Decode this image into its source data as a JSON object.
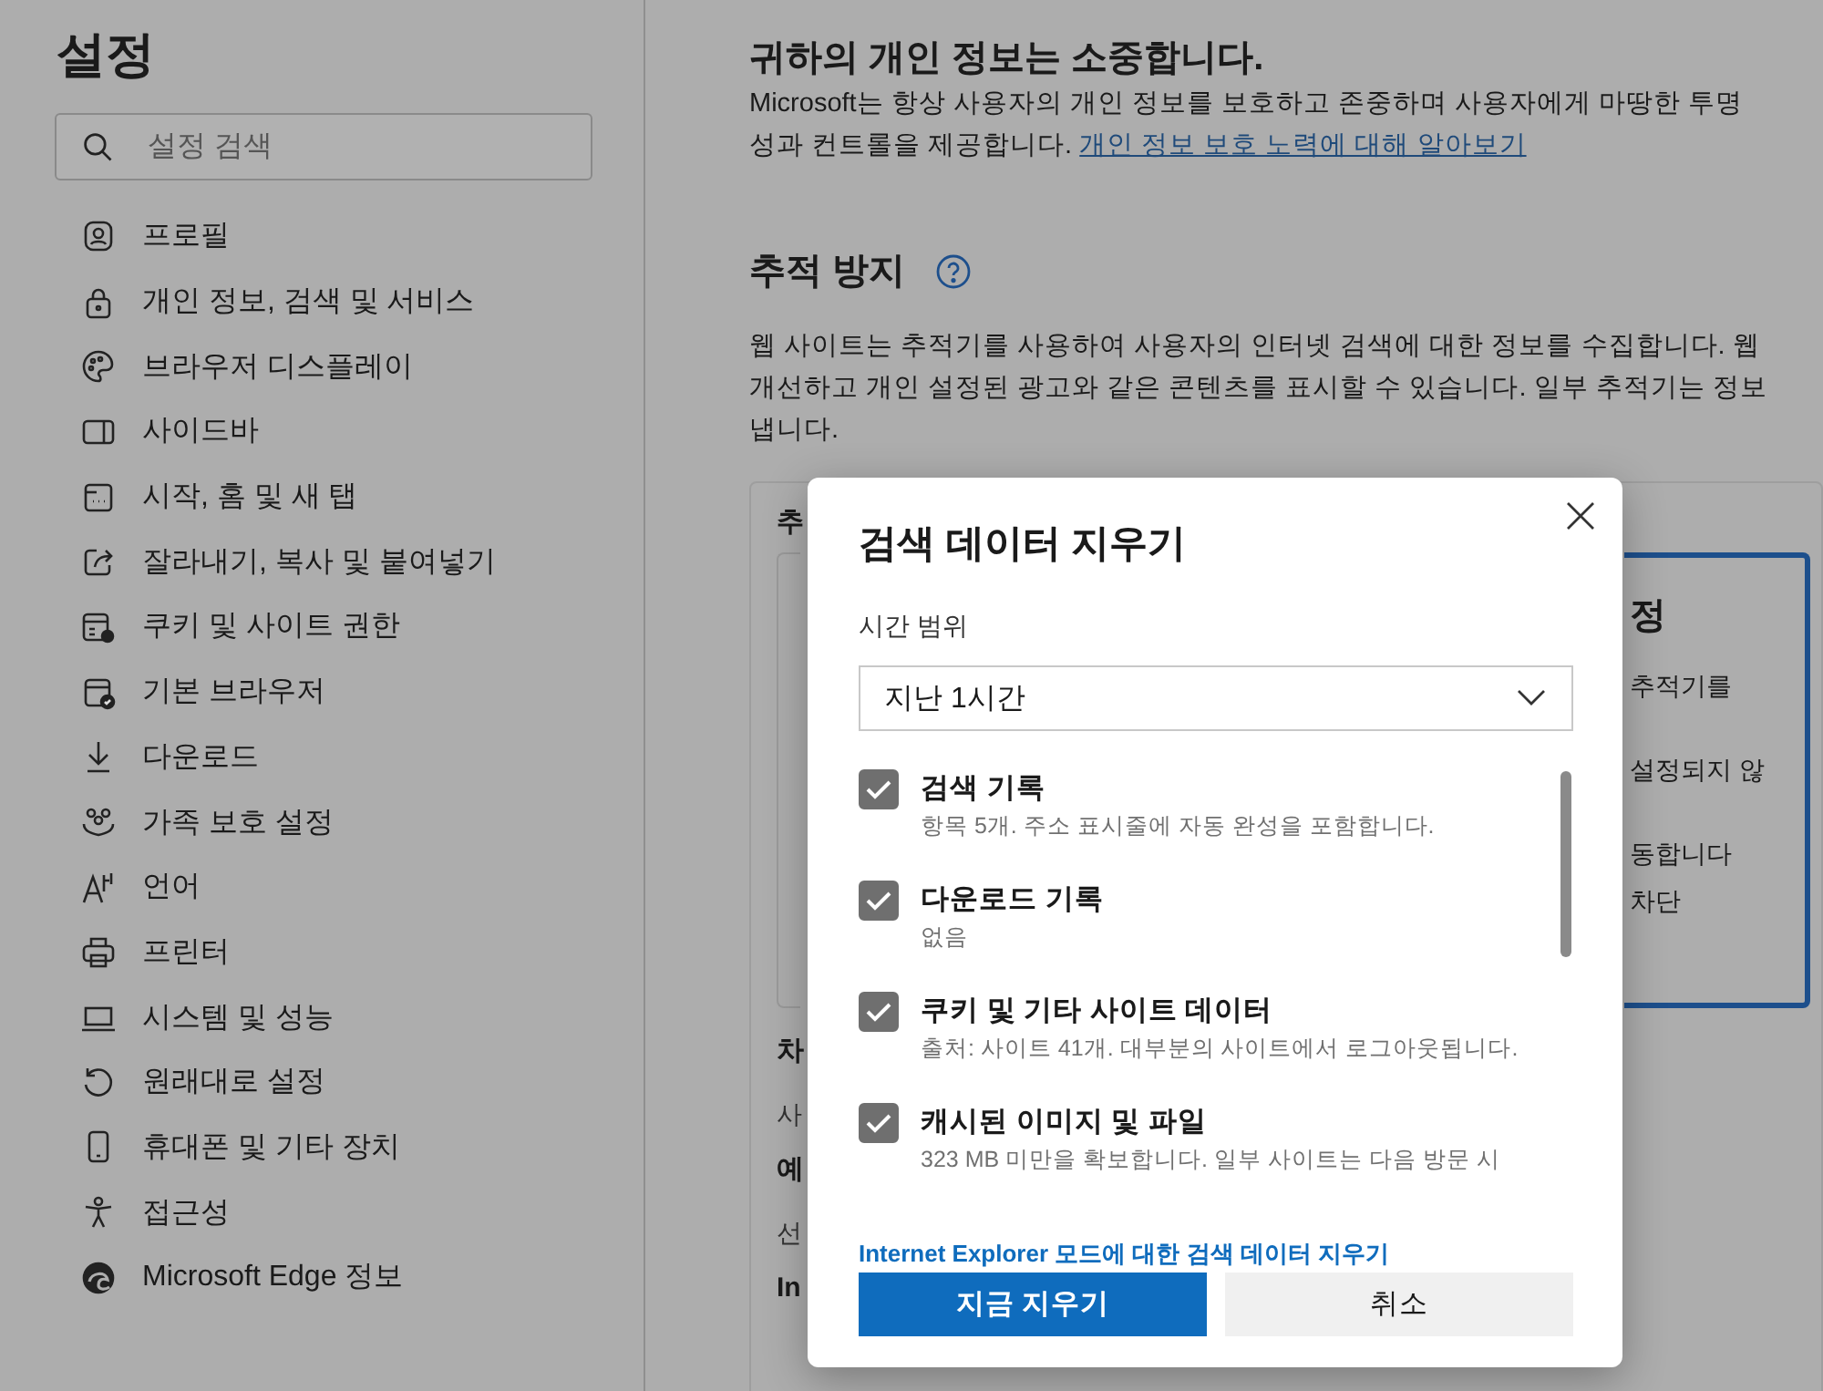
{
  "sidebar": {
    "title": "설정",
    "search": {
      "placeholder": "설정 검색"
    },
    "items": [
      {
        "label": "프로필",
        "selected": false
      },
      {
        "label": "개인 정보, 검색 및 서비스",
        "selected": false
      },
      {
        "label": "브라우저 디스플레이",
        "selected": false
      },
      {
        "label": "사이드바",
        "selected": false
      },
      {
        "label": "시작, 홈 및 새 탭",
        "selected": false
      },
      {
        "label": "잘라내기, 복사 및 붙여넣기",
        "selected": false
      },
      {
        "label": "쿠키 및 사이트 권한",
        "selected": false
      },
      {
        "label": "기본 브라우저",
        "selected": false
      },
      {
        "label": "다운로드",
        "selected": false
      },
      {
        "label": "가족 보호 설정",
        "selected": false
      },
      {
        "label": "언어",
        "selected": false
      },
      {
        "label": "프린터",
        "selected": false
      },
      {
        "label": "시스템 및 성능",
        "selected": false
      },
      {
        "label": "원래대로 설정",
        "selected": false
      },
      {
        "label": "휴대폰 및 기타 장치",
        "selected": false
      },
      {
        "label": "접근성",
        "selected": false
      },
      {
        "label": "Microsoft Edge 정보",
        "selected": false
      }
    ]
  },
  "main": {
    "privacy": {
      "heading": "귀하의 개인 정보는 소중합니다.",
      "lines": [
        "Microsoft는 항상 사용자의 개인 정보를 보호하고 존중하며 사용자에게 마땅한 투명",
        "성과 컨트롤을 제공합니다."
      ],
      "link": "개인 정보 보호 노력에 대해 알아보기"
    },
    "tracking": {
      "heading": "추적 방지",
      "lines": [
        "웹 사이트는 추적기를 사용하여 사용자의 인터넷 검색에 대한 정보를 수집합니다. 웹",
        "개선하고 개인 설정된 광고와 같은 콘텐츠를 표시할 수 있습니다. 일부 추적기는 정보",
        "냅니다."
      ]
    },
    "card": {
      "label": "추",
      "option": {
        "title": "정",
        "lines": [
          "추적기를",
          "설정되지 않",
          "동합니다",
          "차단"
        ]
      },
      "below": [
        {
          "text": "차",
          "kind": "heading"
        },
        {
          "text": "사",
          "kind": "text"
        },
        {
          "text": "예",
          "kind": "heading"
        },
        {
          "text": "선",
          "kind": "text"
        },
        {
          "text": "In",
          "kind": "heading"
        }
      ]
    }
  },
  "dialog": {
    "title": "검색 데이터 지우기",
    "range_label": "시간 범위",
    "range_value": "지난 1시간",
    "items": [
      {
        "title": "검색 기록",
        "detail": "항목 5개. 주소 표시줄에 자동 완성을 포함합니다.",
        "checked": true
      },
      {
        "title": "다운로드 기록",
        "detail": "없음",
        "checked": true
      },
      {
        "title": "쿠키 및 기타 사이트 데이터",
        "detail": "출처: 사이트 41개. 대부분의 사이트에서 로그아웃됩니다.",
        "checked": true
      },
      {
        "title": "캐시된 이미지 및 파일",
        "detail": "323 MB 미만을 확보합니다. 일부 사이트는 다음 방문 시",
        "checked": true
      }
    ],
    "link": "Internet Explorer 모드에 대한 검색 데이터 지우기",
    "buttons": [
      {
        "label": "지금 지우기",
        "kind": "primary"
      },
      {
        "label": "취소",
        "kind": "secondary"
      }
    ]
  }
}
